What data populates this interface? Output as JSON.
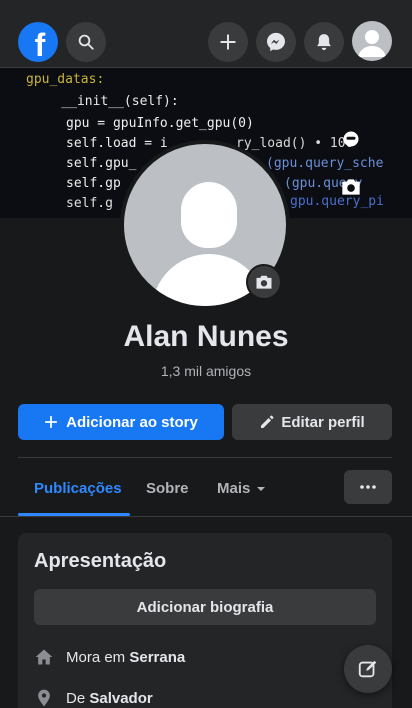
{
  "header": {
    "logo_letter": "f",
    "icons": [
      "search-icon",
      "plus-icon",
      "messenger-icon",
      "bell-icon",
      "profile-avatar"
    ]
  },
  "cover": {
    "code_lines": [
      "gpu_datas:",
      "    __init__(self):",
      "gpu = gpuInfo.get_gpu(0)",
      "self.load = i",
      "self.gpu_",
      "self.gp",
      "self.g"
    ],
    "code_right": [
      "ry_load() • 100",
      "(gpu.query_sche",
      "(gpu.query",
      "gpu.query_pi"
    ]
  },
  "profile": {
    "name": "Alan Nunes",
    "friends": "1,3 mil amigos"
  },
  "actions": {
    "add_story": "Adicionar ao story",
    "edit_profile": "Editar perfil"
  },
  "tabs": [
    {
      "label": "Publicações",
      "active": true
    },
    {
      "label": "Sobre",
      "active": false
    },
    {
      "label": "Mais",
      "active": false
    }
  ],
  "intro": {
    "title": "Apresentação",
    "add_bio": "Adicionar biografia",
    "lives_prefix": "Mora em",
    "lives_city": "Serrana",
    "from_prefix": "De",
    "from_city": "Salvador"
  },
  "colors": {
    "accent": "#1877f2",
    "link": "#2d88ff",
    "background": "#18191a",
    "surface": "#242526"
  }
}
